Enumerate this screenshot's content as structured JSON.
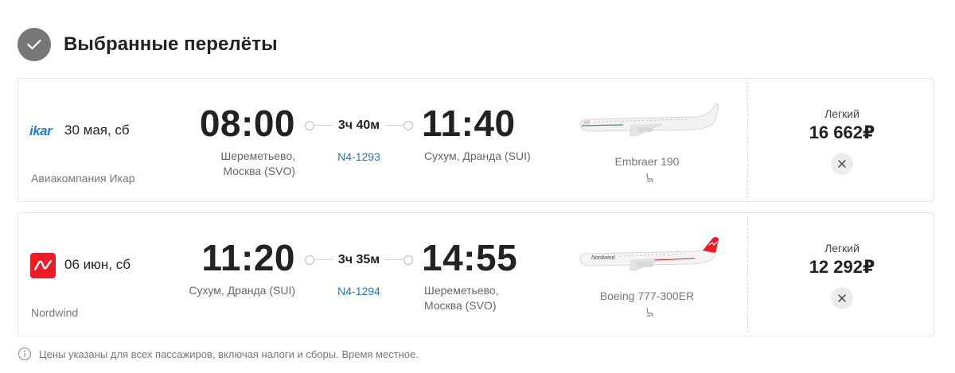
{
  "header": {
    "title": "Выбранные перелёты"
  },
  "flights": [
    {
      "airline_logo": "ikar",
      "date": "30 мая, сб",
      "airline": "Авиакомпания Икар",
      "departure": {
        "time": "08:00",
        "airport": "Шереметьево, Москва (SVO)",
        "airport_line1": "Шереметьево,",
        "airport_line2": "Москва (SVO)"
      },
      "duration": "3ч 40м",
      "flight_number": "N4-1293",
      "arrival": {
        "time": "11:40",
        "airport": "Сухум, Дранда (SUI)",
        "airport_line1": "Сухум, Дранда (SUI)",
        "airport_line2": ""
      },
      "aircraft": "Embraer 190",
      "fare": "Легкий",
      "price": "16 662₽"
    },
    {
      "airline_logo": "nordwind",
      "date": "06 июн, сб",
      "airline": "Nordwind",
      "departure": {
        "time": "11:20",
        "airport": "Сухум, Дранда (SUI)",
        "airport_line1": "Сухум, Дранда (SUI)",
        "airport_line2": ""
      },
      "duration": "3ч 35м",
      "flight_number": "N4-1294",
      "arrival": {
        "time": "14:55",
        "airport": "Шереметьево, Москва (SVO)",
        "airport_line1": "Шереметьево,",
        "airport_line2": "Москва (SVO)"
      },
      "aircraft": "Boeing 777-300ER",
      "fare": "Легкий",
      "price": "12 292₽"
    }
  ],
  "footnote": "Цены указаны для всех пассажиров, включая налоги и сборы. Время местное.",
  "colors": {
    "accent_link": "#2a73c4",
    "nordwind_red": "#ed1c24",
    "ikar_blue": "#1d7fd6",
    "check_circle": "#777777"
  },
  "icons": [
    "check-icon",
    "seat-icon",
    "close-icon",
    "info-icon",
    "plane-icon"
  ]
}
